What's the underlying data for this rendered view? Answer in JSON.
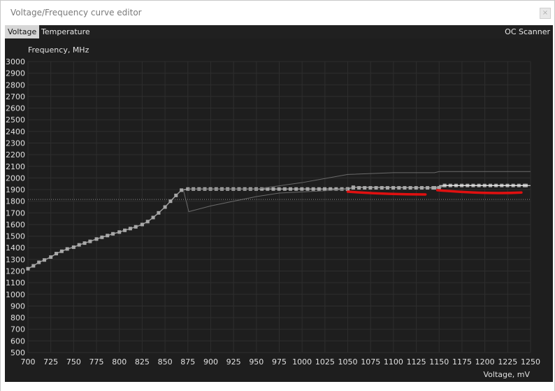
{
  "window": {
    "title": "Voltage/Frequency curve editor",
    "close_glyph": "×"
  },
  "tabs": [
    {
      "label": "Voltage",
      "active": true
    },
    {
      "label": "Temperature",
      "active": false
    }
  ],
  "oc_scanner_label": "OC Scanner",
  "colors": {
    "panel_bg": "#1e1e1e",
    "grid": "#2e2e2e",
    "curve": "#9a9a9a",
    "point": "#a8a8a8",
    "annotation": "#e01010"
  },
  "chart_data": {
    "type": "line",
    "title": "",
    "ylabel": "Frequency, MHz",
    "xlabel": "Voltage, mV",
    "xlim": [
      700,
      1250
    ],
    "ylim": [
      500,
      3000
    ],
    "x_ticks": [
      "700",
      "725",
      "750",
      "775",
      "800",
      "825",
      "850",
      "875",
      "900",
      "925",
      "950",
      "975",
      "1000",
      "1025",
      "1050",
      "1075",
      "1100",
      "1125",
      "1150",
      "1175",
      "1200",
      "1225",
      "1250"
    ],
    "y_ticks": [
      "500",
      "600",
      "700",
      "800",
      "900",
      "1000",
      "1100",
      "1200",
      "1300",
      "1400",
      "1500",
      "1600",
      "1700",
      "1800",
      "1900",
      "2000",
      "2100",
      "2200",
      "2300",
      "2400",
      "2500",
      "2600",
      "2700",
      "2800",
      "2900",
      "3000"
    ],
    "grid": true,
    "series": [
      {
        "role": "curve",
        "x": [
          700,
          706,
          712,
          718,
          725,
          731,
          737,
          743,
          750,
          756,
          762,
          768,
          775,
          781,
          787,
          793,
          800,
          806,
          812,
          818,
          825,
          831,
          837,
          843,
          850,
          856,
          862,
          868,
          875,
          1050,
          1056,
          1145,
          1150,
          1156,
          1245
        ],
        "y": [
          1220,
          1245,
          1275,
          1295,
          1320,
          1350,
          1370,
          1390,
          1405,
          1425,
          1440,
          1455,
          1475,
          1490,
          1505,
          1520,
          1535,
          1550,
          1565,
          1580,
          1600,
          1625,
          1660,
          1700,
          1750,
          1800,
          1850,
          1895,
          1905,
          1905,
          1920,
          1915,
          1915,
          1935,
          1935
        ]
      },
      {
        "role": "upper-line",
        "x": [
          875,
          900,
          950,
          1000,
          1050,
          1100,
          1145,
          1150,
          1250
        ],
        "y": [
          1905,
          1905,
          1905,
          1960,
          2030,
          2045,
          2045,
          2055,
          2055
        ]
      },
      {
        "role": "lower-line",
        "x": [
          870,
          876,
          900,
          950,
          975,
          1000,
          1025,
          1050
        ],
        "y": [
          1900,
          1710,
          1760,
          1840,
          1870,
          1880,
          1890,
          1905
        ]
      },
      {
        "role": "dotted-reference",
        "x": [
          700,
          1250
        ],
        "y": [
          1815,
          1815
        ]
      },
      {
        "role": "white-reference",
        "x": [
          1150,
          1250
        ],
        "y": [
          1935,
          1935
        ]
      }
    ]
  }
}
